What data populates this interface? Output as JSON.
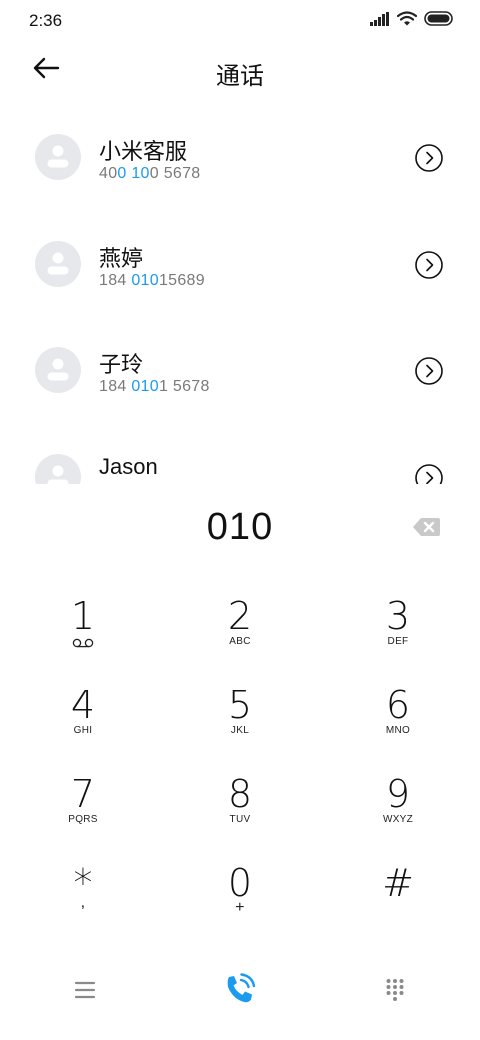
{
  "status_bar": {
    "time": "2:36"
  },
  "header": {
    "title": "通话"
  },
  "contacts": [
    {
      "name": "小米客服",
      "number_parts": [
        "40",
        "0 10",
        "0 5678"
      ]
    },
    {
      "name": "燕婷",
      "number_parts": [
        "184 ",
        "010",
        "15689"
      ]
    },
    {
      "name": "子玲",
      "number_parts": [
        "184 ",
        "010",
        "1 5678"
      ]
    },
    {
      "name": "Jason",
      "number_parts": [
        "",
        "",
        ""
      ]
    }
  ],
  "dialer": {
    "dialed_number": "010"
  },
  "keypad": {
    "keys": [
      {
        "digit": "1",
        "letters": ""
      },
      {
        "digit": "2",
        "letters": "ABC"
      },
      {
        "digit": "3",
        "letters": "DEF"
      },
      {
        "digit": "4",
        "letters": "GHI"
      },
      {
        "digit": "5",
        "letters": "JKL"
      },
      {
        "digit": "6",
        "letters": "MNO"
      },
      {
        "digit": "7",
        "letters": "PQRS"
      },
      {
        "digit": "8",
        "letters": "TUV"
      },
      {
        "digit": "9",
        "letters": "WXYZ"
      },
      {
        "digit": "*",
        "letters": ","
      },
      {
        "digit": "0",
        "letters": "+"
      },
      {
        "digit": "#",
        "letters": ""
      }
    ]
  },
  "icons": {
    "voicemail": "voicemail-icon",
    "back": "back-arrow-icon",
    "detail": "chevron-circle-icon",
    "backspace": "backspace-icon",
    "menu": "menu-icon",
    "call": "phone-call-icon",
    "dialpad": "dialpad-icon"
  },
  "colors": {
    "accent": "#1b9bf0",
    "avatar_bg": "#e6e8ec",
    "secondary_text": "#7a7a7a"
  }
}
